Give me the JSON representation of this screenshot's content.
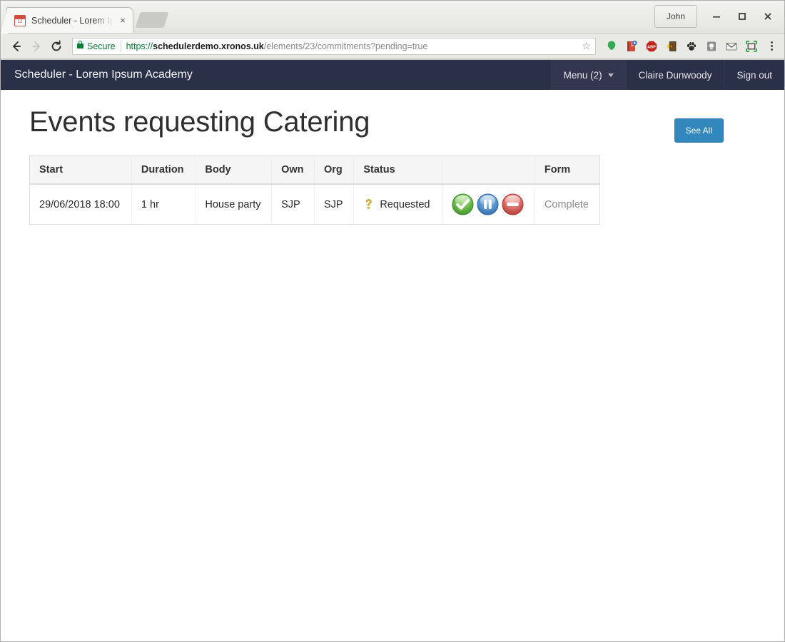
{
  "browser": {
    "tab": {
      "title": "Scheduler - Lorem Ipsum Academy",
      "favicon": "calendar-icon",
      "close_label": "×"
    },
    "new_tab_label": "",
    "profile_label": "John",
    "window_controls": {
      "minimize": "minimize-icon",
      "maximize": "maximize-icon",
      "close": "close-icon"
    },
    "nav": {
      "back": "back-arrow-icon",
      "forward": "forward-arrow-icon",
      "reload": "reload-icon"
    },
    "omnibox": {
      "security_label": "Secure",
      "scheme": "https://",
      "host": "schedulerdemo.xronos.uk",
      "path": "/elements/23/commitments?pending=true",
      "bookmark": "star-icon"
    },
    "extensions": [
      {
        "name": "balloon-icon",
        "color": "#33a852"
      },
      {
        "name": "bookmark-manager-icon",
        "color": "#d4483b"
      },
      {
        "name": "adblock-plus-icon",
        "color": "#c2231d"
      },
      {
        "name": "door-icon",
        "color": "#6b4c25"
      },
      {
        "name": "paw-icon",
        "color": "#2b2b2b"
      },
      {
        "name": "lightbulb-icon",
        "color": "#8a8a8a"
      },
      {
        "name": "envelope-icon",
        "color": "#7d7d7d"
      },
      {
        "name": "screenshot-frame-icon",
        "color": "#2f9e44"
      }
    ],
    "menu_label": "chrome-menu-icon"
  },
  "app": {
    "brand": "Scheduler - Lorem Ipsum Academy",
    "header_bg": "#2b3049",
    "nav": {
      "menu": "Menu (2)",
      "user": "Claire Dunwoody",
      "signout": "Sign out"
    }
  },
  "page": {
    "title": "Events requesting Catering",
    "see_all": "See All",
    "accent_color": "#3287bd"
  },
  "table": {
    "columns": [
      "Start",
      "Duration",
      "Body",
      "Own",
      "Org",
      "Status",
      "",
      "Form"
    ],
    "rows": [
      {
        "start": "29/06/2018 18:00",
        "duration": "1 hr",
        "body": "House party",
        "own": "SJP",
        "org": "SJP",
        "status": "Requested",
        "status_icon": "question-mark-icon",
        "actions": [
          {
            "name": "approve-button",
            "icon": "check-circle-icon",
            "color": "#5aac44"
          },
          {
            "name": "hold-button",
            "icon": "pause-circle-icon",
            "color": "#4a86c8"
          },
          {
            "name": "reject-button",
            "icon": "deny-circle-icon",
            "color": "#d4625e"
          }
        ],
        "form": "Complete"
      }
    ]
  }
}
